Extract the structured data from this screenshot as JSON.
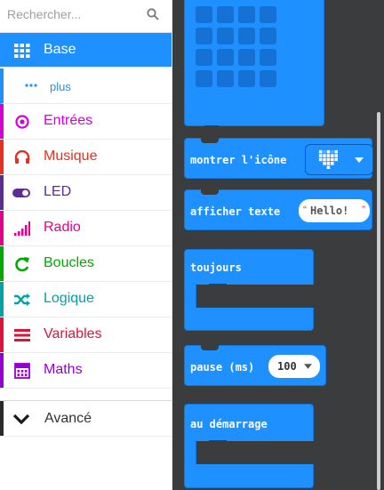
{
  "toolbox": {
    "search_placeholder": "Rechercher...",
    "search_icon": "search-icon",
    "categories": [
      {
        "label": "Base",
        "icon": "grid-icon",
        "color": "#1e90ff"
      },
      {
        "label": "plus",
        "icon": "more-icon",
        "color": "#1e90ff"
      },
      {
        "label": "Entrées",
        "icon": "target-icon",
        "color": "#d400d4"
      },
      {
        "label": "Musique",
        "icon": "headphones-icon",
        "color": "#e63022"
      },
      {
        "label": "LED",
        "icon": "toggle-icon",
        "color": "#5c2d91"
      },
      {
        "label": "Radio",
        "icon": "signal-icon",
        "color": "#e3008c"
      },
      {
        "label": "Boucles",
        "icon": "refresh-icon",
        "color": "#00aa00"
      },
      {
        "label": "Logique",
        "icon": "shuffle-icon",
        "color": "#00a4a6"
      },
      {
        "label": "Variables",
        "icon": "list-icon",
        "color": "#dc143c"
      },
      {
        "label": "Maths",
        "icon": "calculator-icon",
        "color": "#9400d3"
      }
    ],
    "advanced": {
      "label": "Avancé",
      "icon": "chevron-down-icon",
      "color": "#2a2a2a"
    }
  },
  "flyout": {
    "show_icon": "montrer l'icône",
    "show_text": "afficher texte",
    "text_value": "Hello!",
    "forever": "toujours",
    "pause": "pause (ms)",
    "pause_value": "100",
    "on_start": "au démarrage"
  }
}
